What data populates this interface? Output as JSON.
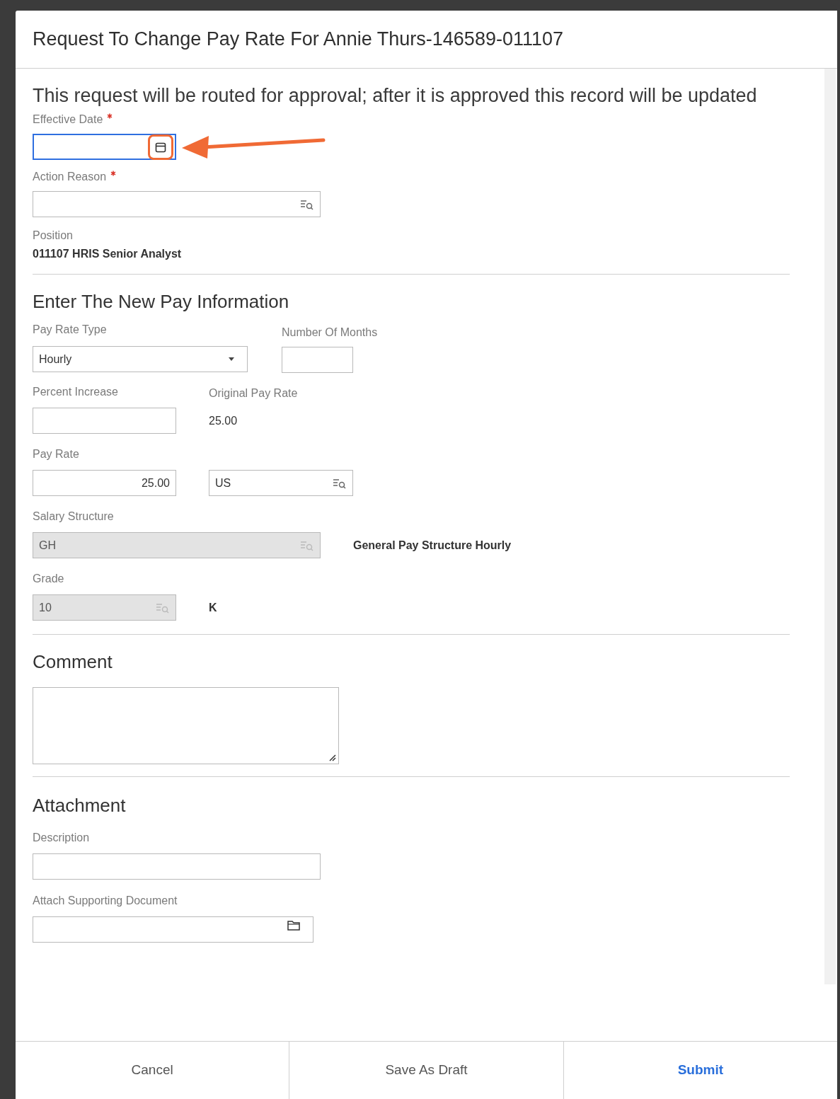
{
  "dialog": {
    "title": "Request To Change Pay Rate For Annie Thurs-146589-011107"
  },
  "notice": "This request will be routed for approval; after it is approved this record will be updated",
  "effective_date": {
    "label": "Effective Date",
    "required": true,
    "focused": true
  },
  "action_reason": {
    "label": "Action Reason",
    "required": true
  },
  "position": {
    "label": "Position",
    "value": "011107 HRIS Senior Analyst"
  },
  "pay_section": {
    "heading": "Enter The New Pay Information",
    "pay_rate_type": {
      "label": "Pay Rate Type",
      "value": "Hourly"
    },
    "number_of_months": {
      "label": "Number Of Months"
    },
    "percent_increase": {
      "label": "Percent Increase"
    },
    "original_pay_rate": {
      "label": "Original Pay Rate",
      "value": "25.00"
    },
    "pay_rate": {
      "label": "Pay Rate",
      "value": "25.00",
      "currency": "US"
    },
    "salary_structure": {
      "label": "Salary Structure",
      "value": "GH",
      "disabled": true,
      "description": "General Pay Structure Hourly"
    },
    "grade": {
      "label": "Grade",
      "value": "10",
      "disabled": true,
      "description": "K"
    }
  },
  "comment_section": {
    "heading": "Comment"
  },
  "attachment_section": {
    "heading": "Attachment",
    "description_label": "Description",
    "document_label": "Attach Supporting Document"
  },
  "buttons": [
    {
      "label": "Cancel",
      "kind": "plain"
    },
    {
      "label": "Save As Draft",
      "kind": "plain"
    },
    {
      "label": "Submit",
      "kind": "primary"
    }
  ]
}
